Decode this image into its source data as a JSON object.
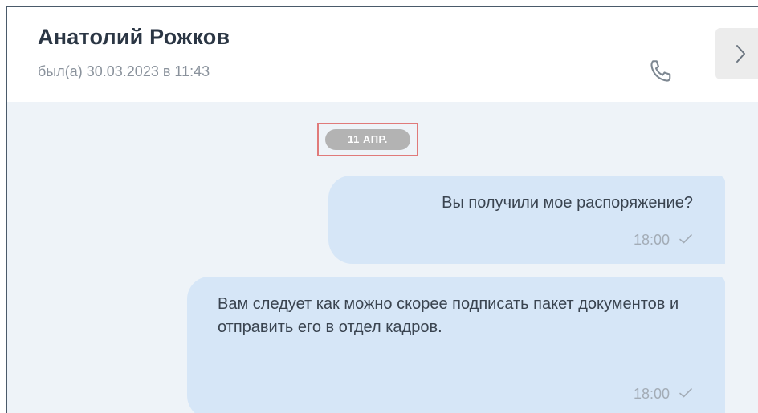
{
  "header": {
    "contact_name": "Анатолий Рожков",
    "status": "был(а) 30.03.2023 в 11:43",
    "call_icon": "phone-icon",
    "next_icon": "chevron-right-icon"
  },
  "chat": {
    "date_separator": "11 АПР.",
    "messages": [
      {
        "text": "Вы получили мое распоряжение?",
        "time": "18:00",
        "status_icon": "check-icon"
      },
      {
        "text": "Вам следует как можно скорее подписать пакет документов и отправить его в отдел кадров.",
        "time": "18:00",
        "status_icon": "check-icon"
      }
    ]
  },
  "colors": {
    "bubble": "#d6e6f7",
    "chat_background": "#eef3f8",
    "date_chip": "#b3b3b3",
    "highlight_border": "#e07a7a"
  }
}
